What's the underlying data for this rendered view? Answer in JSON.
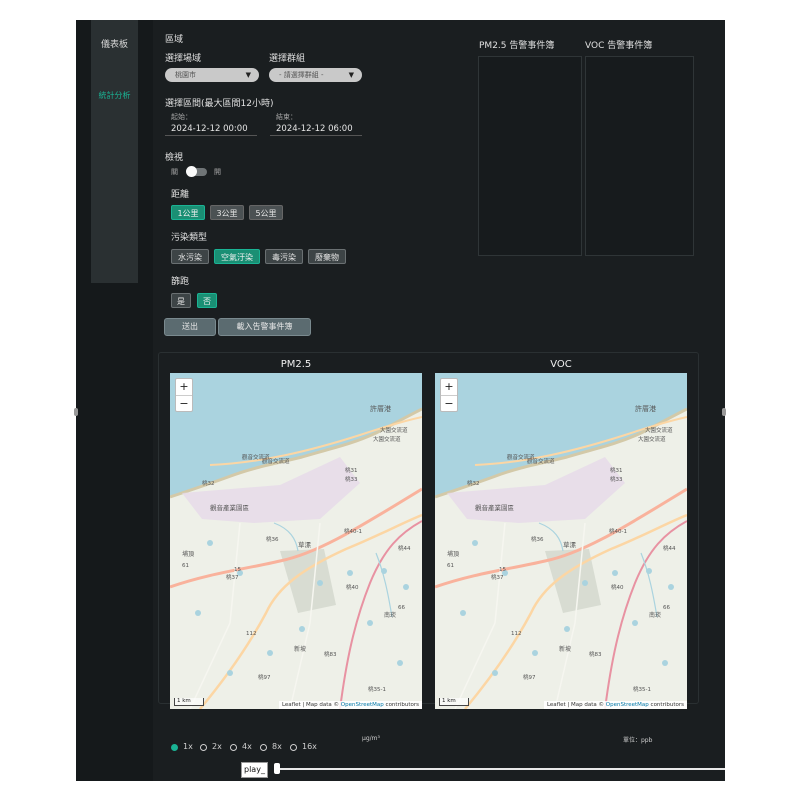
{
  "sidebar": {
    "items": [
      {
        "label": "儀表板",
        "active": false
      },
      {
        "label": "統計分析",
        "active": true
      }
    ]
  },
  "filters": {
    "section_title": "區域",
    "region_label": "選擇場域",
    "region_value": "桃園市",
    "group_label": "選擇群組",
    "group_placeholder": "- 請選擇群組 -",
    "range_label": "選擇區間(最大區間12小時)",
    "start_label": "起始：",
    "start_value": "2024-12-12 00:00",
    "end_label": "結束：",
    "end_value": "2024-12-12 06:00",
    "view_label": "檢視",
    "toggle_off_label": "關",
    "toggle_on_label": "開",
    "distance_label": "距離",
    "distance_options": [
      {
        "label": "1公里",
        "selected": true
      },
      {
        "label": "3公里",
        "selected": false
      },
      {
        "label": "5公里",
        "selected": false
      }
    ],
    "pollution_label": "污染類型",
    "pollution_options": [
      {
        "label": "水污染",
        "selected": false
      },
      {
        "label": "空氣汙染",
        "selected": true
      },
      {
        "label": "毒污染",
        "selected": false
      },
      {
        "label": "廢棄物",
        "selected": false
      }
    ],
    "filter_label": "篩跑",
    "filter_options": [
      {
        "label": "是",
        "selected": false
      },
      {
        "label": "否",
        "selected": true
      }
    ],
    "submit_label": "送出",
    "load_label": "載入告警事件簿"
  },
  "logs": {
    "pm25_title": "PM2.5 告警事件簿",
    "voc_title": "VOC 告警事件簿"
  },
  "maps": [
    {
      "title": "PM2.5",
      "unit": "μg/m³",
      "place_labels": [
        "許厝港",
        "大園交流道",
        "大園交流道",
        "觀音交流道",
        "觀音交流道",
        "桃31",
        "桃33",
        "桃32",
        "觀音產業園區",
        "桃36",
        "桃40-1",
        "草漯",
        "桃44",
        "埔頂",
        "桃37",
        "桃40",
        "桃83",
        "新坡",
        "桃97",
        "桃35-1",
        "南崁",
        "112",
        "15",
        "61",
        "66"
      ],
      "attribution_prefix": "Leaflet | Map data ©",
      "attribution_link": "OpenStreetMap",
      "attribution_suffix": "contributors",
      "scale": "1 km"
    },
    {
      "title": "VOC",
      "unit": "單位：ppb",
      "place_labels": [
        "許厝港",
        "大園交流道",
        "大園交流道",
        "觀音交流道",
        "觀音交流道",
        "桃31",
        "桃33",
        "桃32",
        "觀音產業園區",
        "桃36",
        "桃40-1",
        "草漯",
        "桃44",
        "埔頂",
        "桃37",
        "桃40",
        "桃83",
        "新坡",
        "桃97",
        "桃35-1",
        "南崁",
        "112",
        "15",
        "61",
        "66"
      ],
      "attribution_prefix": "Leaflet | Map data ©",
      "attribution_link": "OpenStreetMap",
      "attribution_suffix": "contributors",
      "scale": "1 km"
    }
  ],
  "zoom": {
    "in": "+",
    "out": "−"
  },
  "playback": {
    "speeds": [
      {
        "label": "1x",
        "selected": true
      },
      {
        "label": "2x",
        "selected": false
      },
      {
        "label": "4x",
        "selected": false
      },
      {
        "label": "8x",
        "selected": false
      },
      {
        "label": "16x",
        "selected": false
      }
    ],
    "play_label": "play_",
    "progress": 0.0
  },
  "colors": {
    "accent": "#1ab394",
    "sea": "#aad3df",
    "land": "#eef0e8",
    "motorway": "#e892a2",
    "trunk": "#f9b29c",
    "primary": "#fcd6a4"
  }
}
